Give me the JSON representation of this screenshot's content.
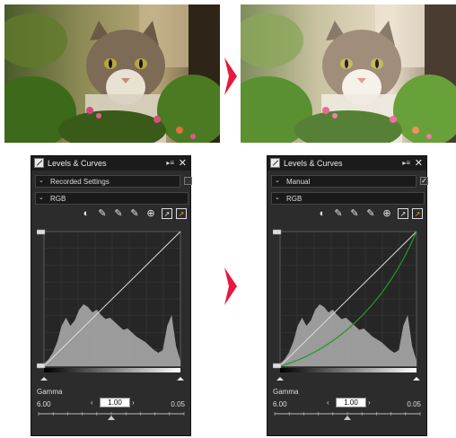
{
  "panels": [
    {
      "title": "Levels & Curves",
      "settings_value": "Recorded Settings",
      "settings_checked": false,
      "channel_value": "RGB",
      "gamma_label": "Gamma",
      "gamma_value": "1.00",
      "gamma_min": "6.00",
      "gamma_max": "0.05",
      "curve_adjusted": false
    },
    {
      "title": "Levels & Curves",
      "settings_value": "Manual",
      "settings_checked": true,
      "channel_value": "RGB",
      "gamma_label": "Gamma",
      "gamma_value": "1.00",
      "gamma_min": "6.00",
      "gamma_max": "0.05",
      "curve_adjusted": true
    }
  ],
  "icons": {
    "menu": "▸≡",
    "close": "✕",
    "chevron": "⌄",
    "check": "✓",
    "step_left": "‹",
    "step_right": "›"
  },
  "colors": {
    "arrow": "#e8173b",
    "panel_bg": "#2c2c2c",
    "curve_default": "#dddddd",
    "curve_adjusted": "#1f9a2e",
    "histogram": "#a8a8a8"
  }
}
